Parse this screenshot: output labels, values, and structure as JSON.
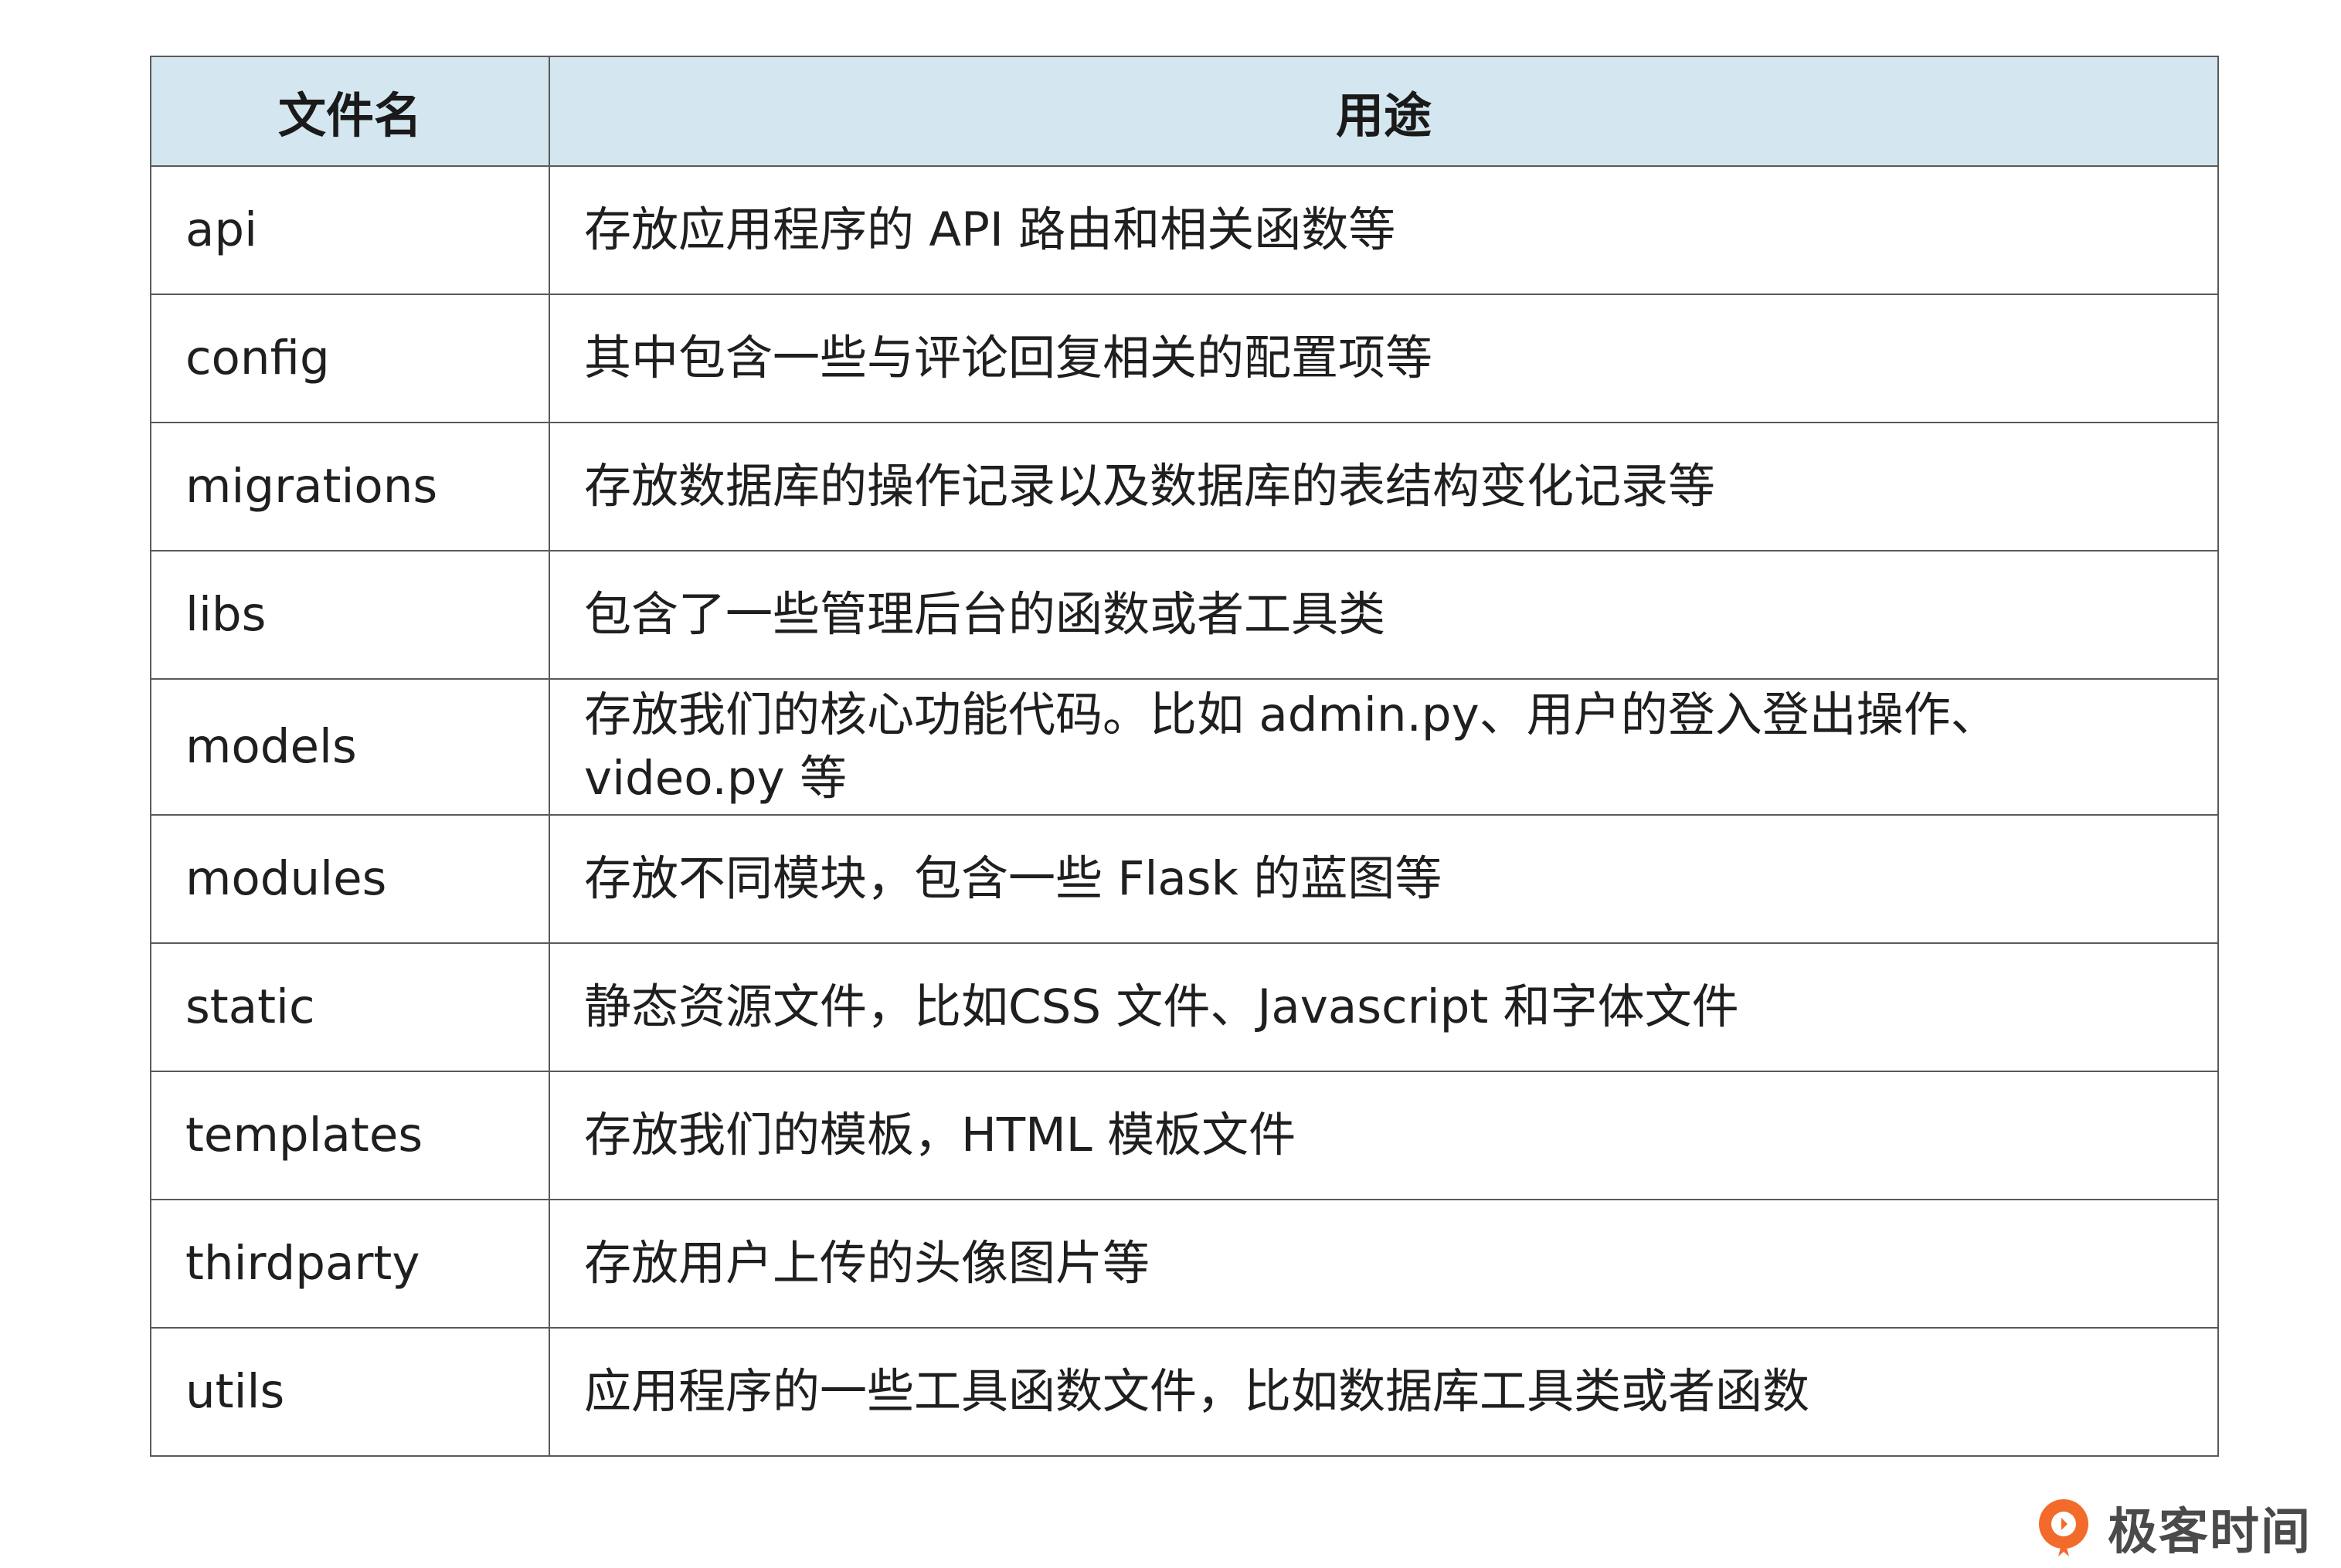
{
  "table": {
    "headers": [
      "文件名",
      "用途"
    ],
    "rows": [
      {
        "name": "api",
        "purpose": "存放应用程序的 API 路由和相关函数等"
      },
      {
        "name": "config",
        "purpose": "其中包含一些与评论回复相关的配置项等"
      },
      {
        "name": "migrations",
        "purpose": "存放数据库的操作记录以及数据库的表结构变化记录等"
      },
      {
        "name": "libs",
        "purpose": "包含了一些管理后台的函数或者工具类"
      },
      {
        "name": "models",
        "purpose": "存放我们的核心功能代码。比如 admin.py、用户的登入登出操作、video.py 等"
      },
      {
        "name": "modules",
        "purpose": "存放不同模块，包含一些 Flask 的蓝图等"
      },
      {
        "name": "static",
        "purpose": "静态资源文件，比如CSS 文件、Javascript 和字体文件"
      },
      {
        "name": "templates",
        "purpose": "存放我们的模板，HTML 模板文件"
      },
      {
        "name": "thirdparty",
        "purpose": "存放用户上传的头像图片等"
      },
      {
        "name": "utils",
        "purpose": "应用程序的一些工具函数文件，比如数据库工具类或者函数"
      }
    ]
  },
  "brand": {
    "text": "极客时间",
    "logo_icon": "geektime-logo-icon",
    "accent_color": "#f26b2a"
  }
}
